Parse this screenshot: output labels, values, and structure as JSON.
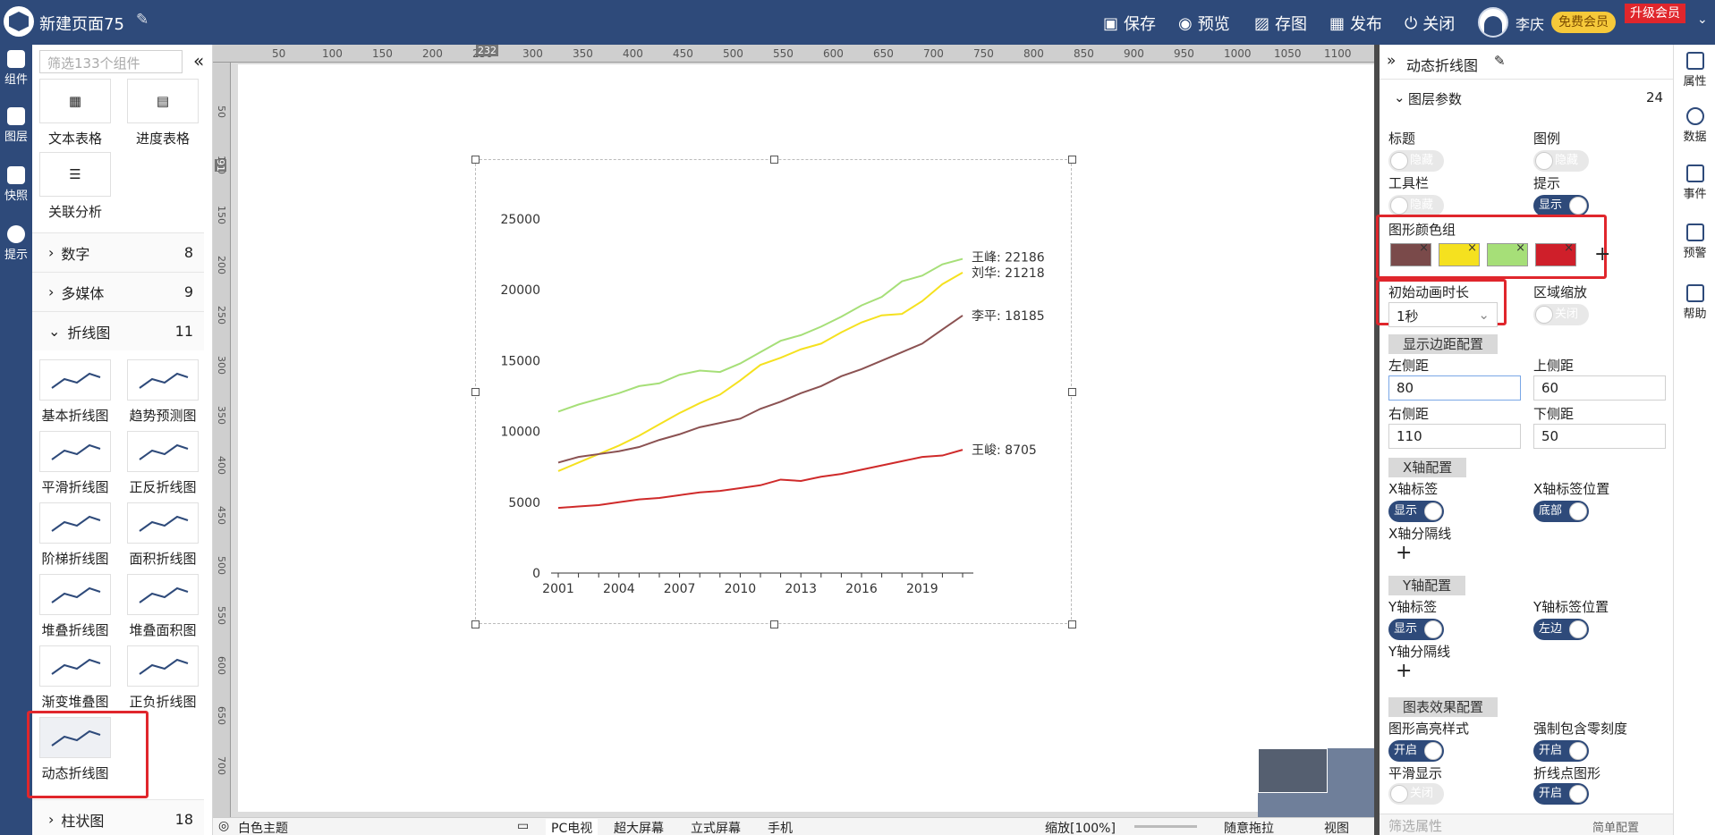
{
  "header": {
    "title": "新建页面75",
    "actions": [
      {
        "icon": "save-icon",
        "label": "保存"
      },
      {
        "icon": "preview-icon",
        "label": "预览"
      },
      {
        "icon": "image-save-icon",
        "label": "存图"
      },
      {
        "icon": "publish-icon",
        "label": "发布"
      },
      {
        "icon": "power-icon",
        "label": "关闭"
      }
    ],
    "user": "李庆",
    "member_badge": "免费会员",
    "upgrade": "升级会员",
    "accent": "#2e4a7a"
  },
  "left_rail": [
    {
      "icon": "component-icon",
      "label": "组件"
    },
    {
      "icon": "layers-icon",
      "label": "图层"
    },
    {
      "icon": "camera-icon",
      "label": "快照"
    },
    {
      "icon": "bulb-icon",
      "label": "提示"
    }
  ],
  "component_panel": {
    "search_placeholder": "筛选133个组件",
    "top_tiles": [
      "文本表格",
      "进度表格",
      "关联分析"
    ],
    "categories": [
      {
        "label": "数字",
        "count": "8"
      },
      {
        "label": "多媒体",
        "count": "9"
      },
      {
        "label": "折线图",
        "count": "11"
      }
    ],
    "line_tiles": [
      "基本折线图",
      "趋势预测图",
      "平滑折线图",
      "正反折线图",
      "阶梯折线图",
      "面积折线图",
      "堆叠折线图",
      "堆叠面积图",
      "渐变堆叠图",
      "正负折线图",
      "动态折线图"
    ],
    "bottom_category": {
      "label": "柱状图",
      "count": "18"
    }
  },
  "ruler": {
    "top_ticks": [
      "50",
      "100",
      "150",
      "200",
      "250",
      "300",
      "350",
      "400",
      "450",
      "500",
      "550",
      "600",
      "650",
      "700",
      "750",
      "800",
      "850",
      "900",
      "950",
      "1000",
      "1050",
      "1100"
    ],
    "left_ticks": [
      "50",
      "100",
      "150",
      "200",
      "250",
      "300",
      "350",
      "400",
      "450",
      "500",
      "550",
      "600",
      "650",
      "700"
    ],
    "marker": "232",
    "marker_left": "91"
  },
  "bottom_bar": {
    "theme": "白色主题",
    "screens": [
      "PC电视",
      "超大屏幕",
      "立式屏幕",
      "手机"
    ],
    "zoom": "缩放[100%]",
    "drag": "随意拖拉",
    "view": "视图"
  },
  "right_panel": {
    "title": "动态折线图",
    "section": "图层参数",
    "section_count": "24",
    "labels": {
      "title": "标题",
      "legend": "图例",
      "toolbar": "工具栏",
      "tooltip": "提示",
      "colors": "图形颜色组",
      "anim": "初始动画时长",
      "zoom": "区域缩放",
      "margin_section": "显示边距配置",
      "left": "左侧距",
      "top": "上侧距",
      "right": "右侧距",
      "bottom": "下侧距",
      "x_section": "X轴配置",
      "x_label": "X轴标签",
      "x_label_pos": "X轴标签位置",
      "x_split": "X轴分隔线",
      "y_section": "Y轴配置",
      "y_label": "Y轴标签",
      "y_label_pos": "Y轴标签位置",
      "y_split": "Y轴分隔线",
      "effect_section": "图表效果配置",
      "highlight": "图形高亮样式",
      "zero": "强制包含零刻度",
      "smooth": "平滑显示",
      "symbol": "折线点图形"
    },
    "toggles": {
      "hide": "隐藏",
      "show": "显示",
      "off": "关闭",
      "on": "开启",
      "bottom": "底部",
      "left": "左边"
    },
    "anim_value": "1秒",
    "margins": {
      "left": "80",
      "top": "60",
      "right": "110",
      "bottom": "50"
    },
    "color_group": [
      "#7a4a4a",
      "#f5e11f",
      "#a6df78",
      "#cf1f2a"
    ],
    "filter_placeholder": "筛选属性",
    "simple_config": "简单配置"
  },
  "right_rail": [
    {
      "icon": "property-icon",
      "label": "属性"
    },
    {
      "icon": "data-icon",
      "label": "数据"
    },
    {
      "icon": "event-icon",
      "label": "事件"
    },
    {
      "icon": "alarm-icon",
      "label": "预警"
    },
    {
      "icon": "help-icon",
      "label": "帮助"
    }
  ],
  "chart_data": {
    "type": "line",
    "x": [
      2001,
      2002,
      2003,
      2004,
      2005,
      2006,
      2007,
      2008,
      2009,
      2010,
      2011,
      2012,
      2013,
      2014,
      2015,
      2016,
      2017,
      2018,
      2019,
      2020,
      2021
    ],
    "x_ticks": [
      "2001",
      "2004",
      "2007",
      "2010",
      "2013",
      "2016",
      "2019"
    ],
    "y_ticks": [
      "0",
      "5000",
      "10000",
      "15000",
      "20000",
      "25000"
    ],
    "ylim": [
      0,
      25000
    ],
    "series": [
      {
        "name": "王峰",
        "color": "#a6df78",
        "end_label": "王峰: 22186",
        "values": [
          11400,
          11900,
          12300,
          12700,
          13200,
          13400,
          14000,
          14300,
          14200,
          14800,
          15600,
          16400,
          16800,
          17400,
          18100,
          18900,
          19500,
          20600,
          21000,
          21800,
          22186
        ]
      },
      {
        "name": "刘华",
        "color": "#f5e11f",
        "end_label": "刘华: 21218",
        "values": [
          7200,
          7800,
          8400,
          9000,
          9700,
          10500,
          11300,
          12000,
          12600,
          13600,
          14700,
          15200,
          15800,
          16200,
          17000,
          17700,
          18200,
          18300,
          19200,
          20400,
          21218
        ]
      },
      {
        "name": "李平",
        "color": "#8b5252",
        "end_label": "李平: 18185",
        "values": [
          7800,
          8200,
          8400,
          8600,
          8900,
          9400,
          9800,
          10300,
          10600,
          10900,
          11600,
          12100,
          12700,
          13200,
          13900,
          14400,
          15000,
          15600,
          16200,
          17200,
          18185
        ]
      },
      {
        "name": "王峻",
        "color": "#cf2a2a",
        "end_label": "王峻: 8705",
        "values": [
          4600,
          4700,
          4800,
          5000,
          5200,
          5300,
          5500,
          5700,
          5800,
          6000,
          6200,
          6600,
          6500,
          6800,
          7000,
          7300,
          7600,
          7900,
          8200,
          8300,
          8705
        ]
      }
    ]
  }
}
